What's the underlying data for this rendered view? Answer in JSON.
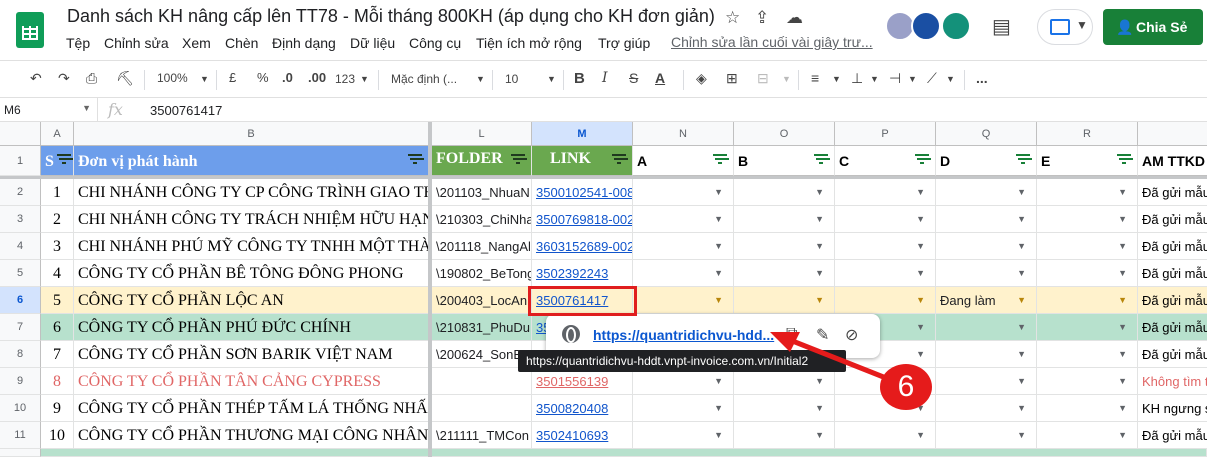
{
  "doc_title": "Danh sách KH nâng cấp lên TT78 - Mỗi tháng 800KH (áp dụng cho KH đơn giản)",
  "menu": [
    "Tệp",
    "Chỉnh sửa",
    "Xem",
    "Chèn",
    "Định dạng",
    "Dữ liệu",
    "Công cụ",
    "Tiện ích mở rộng",
    "Trợ giúp"
  ],
  "last_edit": "Chỉnh sửa lần cuối vài giây trư...",
  "share_label": "Chia Sẻ",
  "toolbar": {
    "zoom": "100%",
    "currency": "£",
    "percent": "%",
    "dec_less": ".0",
    "dec_more": ".00",
    "num_format": "123",
    "font": "Mặc định (...",
    "font_size": "10",
    "bold": "B",
    "more": "..."
  },
  "formula": {
    "name_box": "M6",
    "fx": "fx",
    "value": "3500761417"
  },
  "columns": [
    "A",
    "B",
    "L",
    "M",
    "N",
    "O",
    "P",
    "Q",
    "R"
  ],
  "header_row": {
    "s": "S",
    "b": "Đơn vị phát hành",
    "l": "FOLDER",
    "m": "LINK",
    "n": "A",
    "o": "B",
    "p": "C",
    "q": "D",
    "r": "E",
    "s2": "AM TTKD"
  },
  "rows": [
    {
      "num": "2",
      "a": "1",
      "b": "CHI NHÁNH CÔNG TY CP CÔNG TRÌNH GIAO TH",
      "l": "\\201103_NhuaN",
      "m": "3500102541-008",
      "q": "",
      "am": "Đã gửi mẫu"
    },
    {
      "num": "3",
      "a": "2",
      "b": "CHI NHÁNH CÔNG TY TRÁCH NHIỆM HỮU HẠN",
      "l": "\\210303_ChiNha",
      "m": "3500769818-002",
      "q": "",
      "am": "Đã gửi mẫu"
    },
    {
      "num": "4",
      "a": "3",
      "b": "CHI NHÁNH PHÚ MỸ CÔNG TY TNHH MỘT THÀ",
      "l": "\\201118_NangAl",
      "m": "3603152689-002",
      "q": "",
      "am": "Đã gửi mẫu"
    },
    {
      "num": "5",
      "a": "4",
      "b": "CÔNG TY CỔ PHẦN BÊ TÔNG ĐÔNG PHONG",
      "l": "\\190802_BeTong",
      "m": "3502392243",
      "q": "",
      "am": "Đã gửi mẫu"
    },
    {
      "num": "6",
      "a": "5",
      "b": "CÔNG TY CỔ PHẦN LỘC AN",
      "l": "\\200403_LocAn",
      "m": "3500761417",
      "q": "Đang làm",
      "am": "Đã gửi mẫu"
    },
    {
      "num": "7",
      "a": "6",
      "b": "CÔNG TY CỔ PHẦN PHÚ ĐỨC CHÍNH",
      "l": "\\210831_PhuDu",
      "m": "35",
      "q": "",
      "am": "Đã gửi mẫu"
    },
    {
      "num": "8",
      "a": "7",
      "b": "CÔNG TY CỔ PHẦN SƠN BARIK VIỆT NAM",
      "l": "\\200624_SonB",
      "m": "",
      "q": "",
      "am": "Đã gửi mẫu"
    },
    {
      "num": "9",
      "a": "8",
      "b": "CÔNG TY CỔ PHẦN TÂN CẢNG CYPRESS",
      "l": "",
      "m": "3501556139",
      "q": "",
      "am": "Không tìm t"
    },
    {
      "num": "10",
      "a": "9",
      "b": "CÔNG TY CỔ PHẦN THÉP TẤM LÁ THỐNG NHẤ",
      "l": "",
      "m": "3500820408",
      "q": "",
      "am": "KH ngưng s"
    },
    {
      "num": "11",
      "a": "10",
      "b": "CÔNG TY CỔ PHẦN THƯƠNG MẠI CÔNG NHÂN",
      "l": "\\211111_TMCon",
      "m": "3502410693",
      "q": "",
      "am": "Đã gửi mẫu"
    }
  ],
  "popup": {
    "url": "https://quantridichvu-hdd..."
  },
  "tooltip": "https://quantridichvu-hddt.vnpt-invoice.com.vn/Initial2",
  "step_label": "6",
  "colors": {
    "green_header": "#6aa84f",
    "blue_header": "#6d9eeb",
    "row_sel": "#fff2cc",
    "row_green": "#b7e1cd",
    "accent": "#188038"
  }
}
